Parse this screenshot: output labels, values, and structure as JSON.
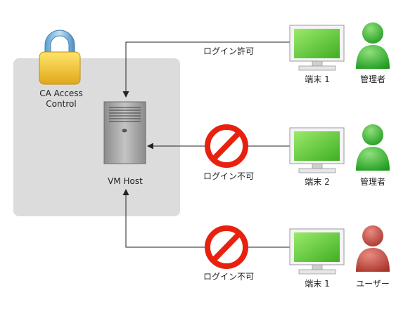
{
  "lock_label": [
    "CA Access",
    "Control"
  ],
  "host_label": "VM Host",
  "colors": {
    "zone_bg": "#dcdcdc",
    "ok_user": "#3fb43a",
    "denied_user": "#c2443a",
    "prohibit": "#e8210f",
    "screen": "#5cc834"
  },
  "connections": [
    {
      "status": "ログイン許可",
      "terminal": "端末 1",
      "user": "管理者",
      "allowed": true
    },
    {
      "status": "ログイン不可",
      "terminal": "端末 2",
      "user": "管理者",
      "allowed": false
    },
    {
      "status": "ログイン不可",
      "terminal": "端末 1",
      "user": "ユーザー",
      "allowed": false
    }
  ]
}
